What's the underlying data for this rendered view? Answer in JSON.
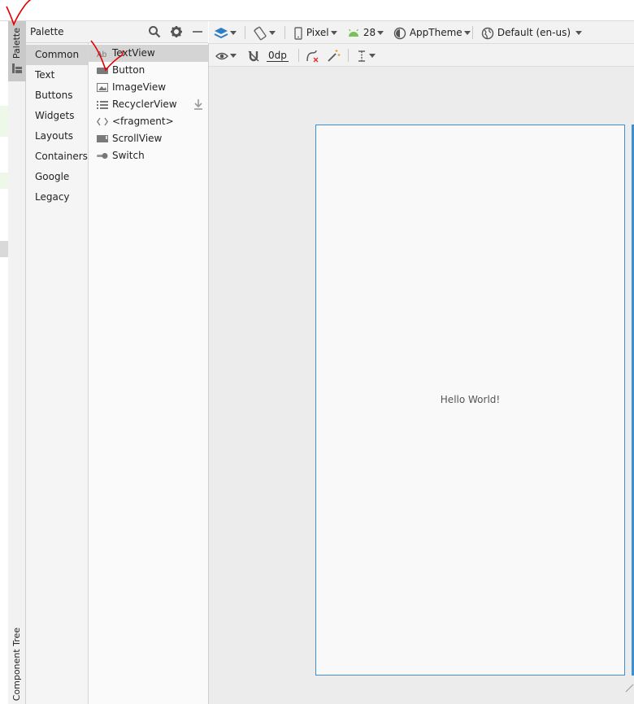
{
  "tool_strip": {
    "palette_tab": "Palette",
    "component_tree_tab": "Component Tree"
  },
  "palette": {
    "title": "Palette",
    "categories": [
      "Common",
      "Text",
      "Buttons",
      "Widgets",
      "Layouts",
      "Containers",
      "Google",
      "Legacy"
    ],
    "selected_category": "Common",
    "widgets": [
      {
        "label": "TextView",
        "icon": "text-ab-icon"
      },
      {
        "label": "Button",
        "icon": "button-icon"
      },
      {
        "label": "ImageView",
        "icon": "image-icon"
      },
      {
        "label": "RecyclerView",
        "icon": "list-icon"
      },
      {
        "label": "<fragment>",
        "icon": "code-brackets-icon"
      },
      {
        "label": "ScrollView",
        "icon": "scrollview-icon"
      },
      {
        "label": "Switch",
        "icon": "switch-icon"
      }
    ]
  },
  "toolbar": {
    "device": "Pixel",
    "api_level": "28",
    "theme": "AppTheme",
    "locale": "Default (en-us)",
    "margin": "0dp"
  },
  "canvas": {
    "hello_text": "Hello World!"
  },
  "colors": {
    "accent": "#3e8fd1",
    "annotation": "#e00000",
    "android_green": "#78c257"
  }
}
